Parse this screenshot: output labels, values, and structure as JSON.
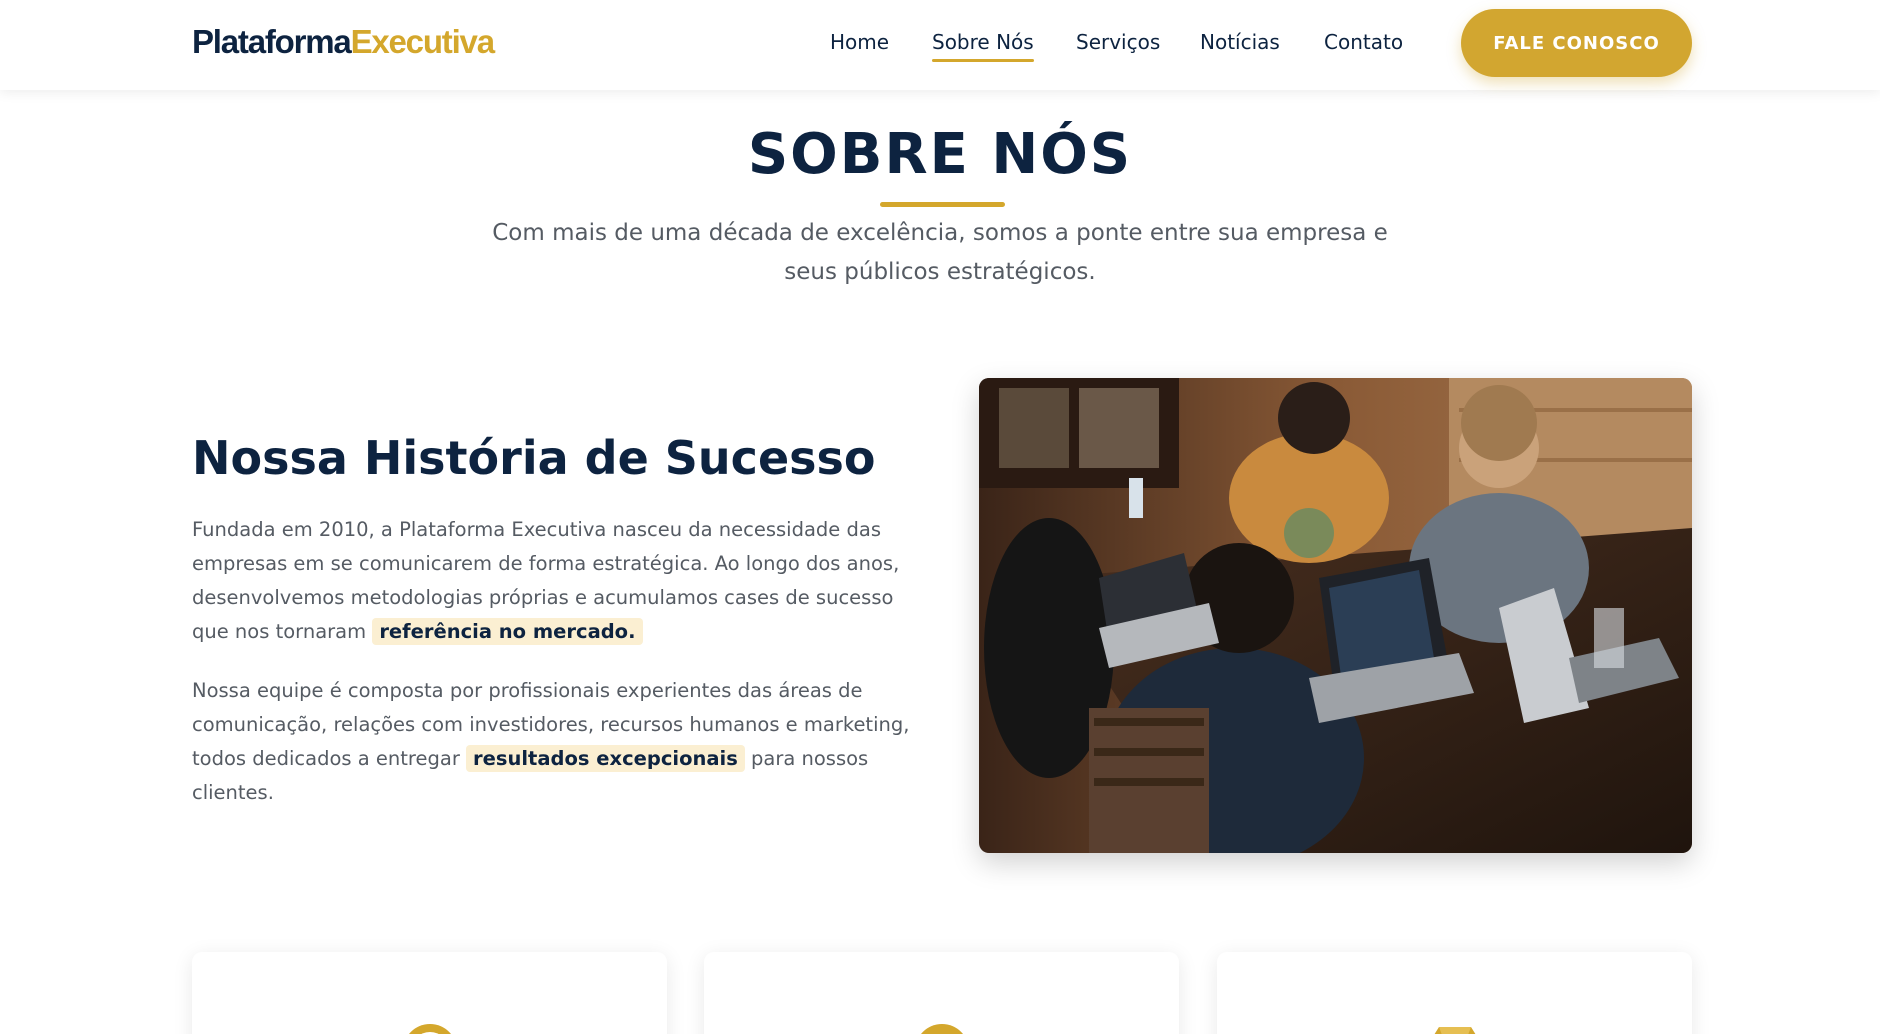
{
  "header": {
    "logo": {
      "part1": "Plataforma",
      "part2": "Executiva"
    },
    "nav": [
      {
        "label": "Home",
        "active": false
      },
      {
        "label": "Sobre Nós",
        "active": true
      },
      {
        "label": "Serviços",
        "active": false
      },
      {
        "label": "Notícias",
        "active": false
      },
      {
        "label": "Contato",
        "active": false
      }
    ],
    "cta_label": "FALE CONOSCO"
  },
  "section": {
    "title": "SOBRE NÓS",
    "subtitle": "Com mais de uma década de excelência, somos a ponte entre sua empresa e seus públicos estratégicos."
  },
  "story": {
    "title": "Nossa História de Sucesso",
    "p1_text": "Fundada em 2010, a Plataforma Executiva nasceu da necessidade das empresas em se comunicarem de forma estratégica. Ao longo dos anos, desenvolvemos metodologias próprias e acumulamos cases de sucesso que nos tornaram",
    "p1_highlight": "referência no mercado.",
    "p2_text": "Nossa equipe é composta por profissionais experientes das áreas de comunicação, relações com investidores, recursos humanos e marketing, todos dedicados a entregar",
    "p2_highlight": "resultados excepcionais",
    "p2_end": "para nossos clientes."
  },
  "image": {
    "alt": "team-working-laptops-photo"
  },
  "cards": [
    {
      "icon": "target-icon"
    },
    {
      "icon": "eye-icon"
    },
    {
      "icon": "gem-icon"
    }
  ],
  "colors": {
    "navy": "#0d2340",
    "gold": "#d4a72c",
    "text": "#555b63",
    "highlight_bg": "#fbefd2"
  }
}
